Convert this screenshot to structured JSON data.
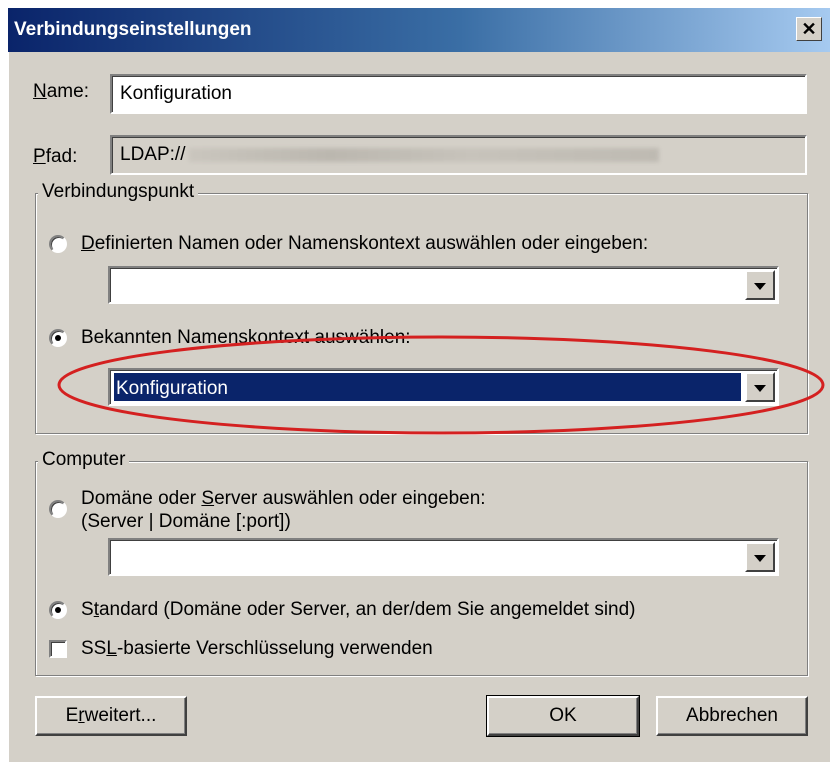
{
  "window": {
    "title": "Verbindungseinstellungen",
    "close_glyph": "✕"
  },
  "name_field": {
    "label": "Name:",
    "label_access": "N",
    "label_rest": "ame:",
    "value": "Konfiguration"
  },
  "path_field": {
    "label": "Pfad:",
    "label_access": "P",
    "label_rest": "fad:",
    "value": "LDAP://"
  },
  "connection_point": {
    "group_label": "Verbindungspunkt",
    "option_dn": {
      "access": "D",
      "rest": "efinierten Namen oder Namenskontext auswählen oder eingeben:",
      "selected": false
    },
    "dn_combo_value": "",
    "option_known": {
      "text": "Bekannten Namenskontext auswählen:",
      "selected": true
    },
    "known_combo_value": "Konfiguration"
  },
  "computer": {
    "group_label": "Computer",
    "option_server": {
      "pre": "Domäne oder ",
      "access": "S",
      "post": "erver auswählen oder eingeben:",
      "line2": "(Server | Domäne [:port])",
      "selected": false
    },
    "server_combo_value": "",
    "option_default": {
      "pre": "S",
      "access": "t",
      "post": "andard (Domäne oder Server, an der/dem Sie angemeldet sind)",
      "selected": true
    },
    "ssl_checkbox": {
      "pre": "SS",
      "access": "L",
      "post": "-basierte Verschlüsselung verwenden",
      "checked": false
    }
  },
  "buttons": {
    "advanced": {
      "pre": "E",
      "access": "r",
      "post": "weitert..."
    },
    "ok": "OK",
    "cancel": "Abbrechen"
  },
  "colors": {
    "titlebar_start": "#0a246a",
    "titlebar_end": "#a6caf0",
    "selection": "#0a246a",
    "annotation": "#d42020",
    "dialog_bg": "#d4d0c8"
  },
  "icons": {
    "close": "close-icon",
    "dropdown": "chevron-down-icon"
  }
}
